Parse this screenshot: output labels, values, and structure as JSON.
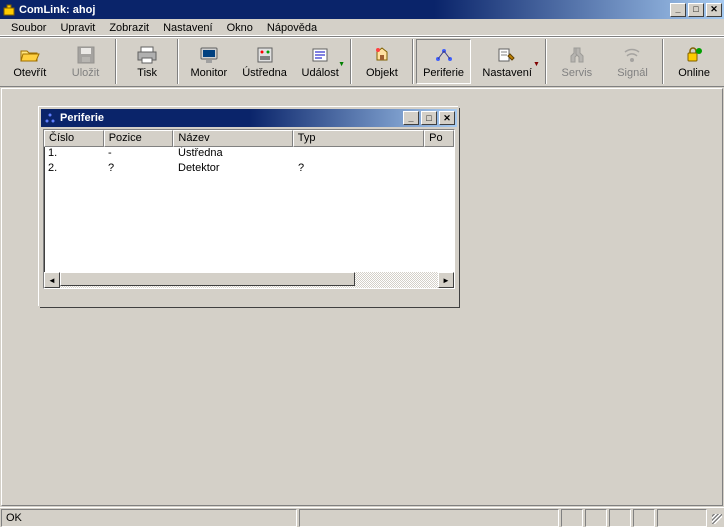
{
  "title": "ComLink: ahoj",
  "menu": {
    "soubor": "Soubor",
    "upravit": "Upravit",
    "zobrazit": "Zobrazit",
    "nastaveni": "Nastavení",
    "okno": "Okno",
    "napoveda": "Nápověda"
  },
  "toolbar": {
    "otevrit": "Otevřít",
    "ulozit": "Uložit",
    "tisk": "Tisk",
    "monitor": "Monitor",
    "ustredna": "Ústředna",
    "udalost": "Událost",
    "objekt": "Objekt",
    "periferie": "Periferie",
    "nastaveni": "Nastavení",
    "servis": "Servis",
    "signal": "Signál",
    "online": "Online"
  },
  "child_window": {
    "title": "Periferie",
    "columns": {
      "cislo": "Číslo",
      "pozice": "Pozice",
      "nazev": "Název",
      "typ": "Typ",
      "po": "Po"
    },
    "rows": [
      {
        "cislo": "1.",
        "pozice": "-",
        "nazev": "Ústředna",
        "typ": ""
      },
      {
        "cislo": "2.",
        "pozice": "?",
        "nazev": "Detektor",
        "typ": "?"
      }
    ]
  },
  "status": {
    "text": "OK"
  }
}
